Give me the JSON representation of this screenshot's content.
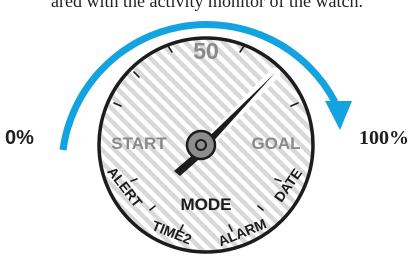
{
  "caption": "ared with the activity monitor of the watch.",
  "dial": {
    "top_value": "50",
    "start": "START",
    "goal": "GOAL",
    "mode": "MODE",
    "alert": "ALERT",
    "time2": "TIME2",
    "alarm": "ALARM",
    "date": "DATE"
  },
  "progress": {
    "start_label": "0%",
    "end_label": "100%"
  },
  "colors": {
    "arrow": "#12a3e0",
    "dial_stripes": "#cfcfcf",
    "text_gray": "#8a8a8a",
    "ink": "#1c1c1c"
  }
}
